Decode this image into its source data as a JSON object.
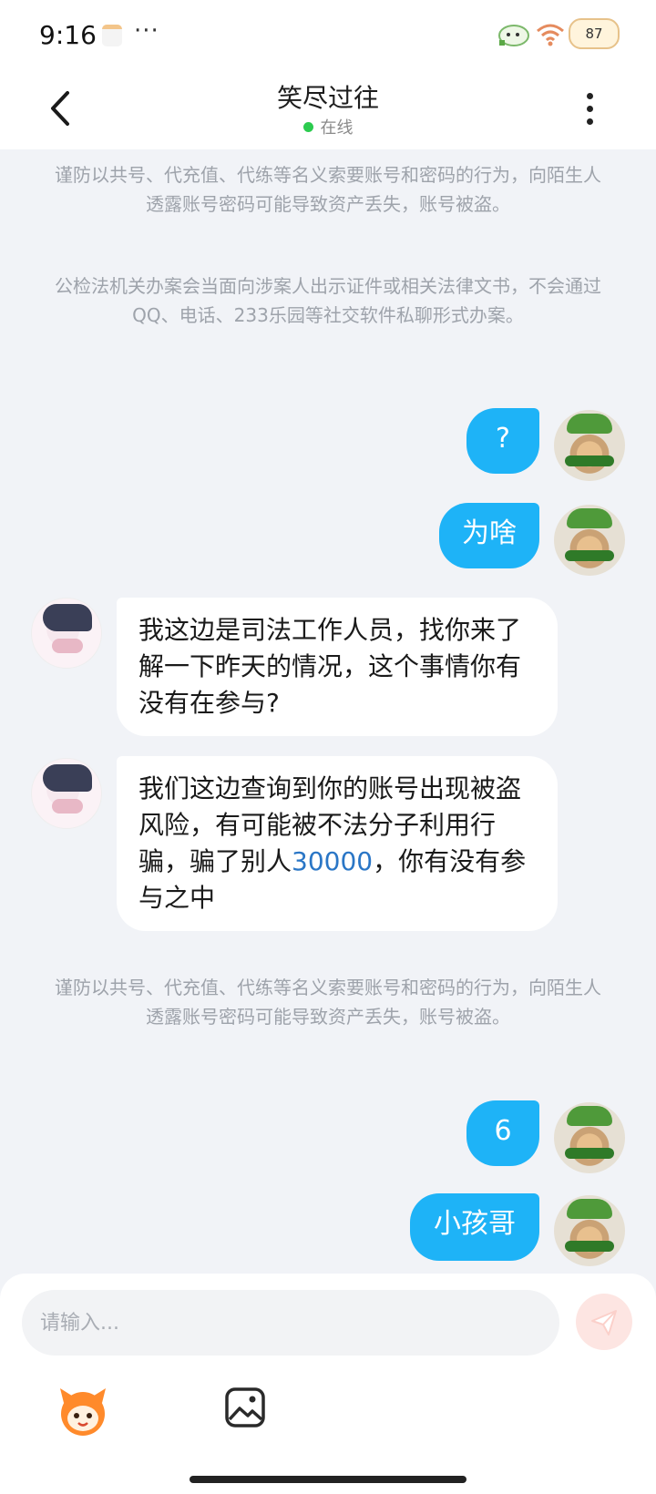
{
  "status_bar": {
    "time": "9:16",
    "more": "···",
    "battery": "87"
  },
  "header": {
    "title": "笑尽过往",
    "status": "在线"
  },
  "messages": {
    "notice1": "谨防以共号、代充值、代练等名义索要账号和密码的行为，向陌生人透露账号密码可能导致资产丢失，账号被盗。",
    "notice2": "公检法机关办案会当面向涉案人出示证件或相关法律文书，不会通过QQ、电话、233乐园等社交软件私聊形式办案。",
    "out1": "?",
    "out2": "为啥",
    "in1": "我这边是司法工作人员，找你来了解一下昨天的情况，这个事情你有没有在参与?",
    "in2_part1": "我们这边查询到你的账号出现被盗风险，有可能被不法分子利用行骗，骗了别人",
    "in2_amount": "30000",
    "in2_part2": "，你有没有参与之中",
    "notice3": "谨防以共号、代充值、代练等名义索要账号和密码的行为，向陌生人透露账号密码可能导致资产丢失，账号被盗。",
    "out3": "6",
    "out4": "小孩哥"
  },
  "composer": {
    "placeholder": "请输入..."
  },
  "colors": {
    "outgoing_bubble": "#1eb3f7",
    "online_dot": "#2ccb4f",
    "amount_link": "#2a76c6",
    "send_button": "#fde5e2"
  },
  "icons": {
    "back": "chevron-left-icon",
    "menu": "more-vertical-icon",
    "send": "paper-plane-icon",
    "emoji": "cartoon-face-icon",
    "image": "image-icon"
  }
}
